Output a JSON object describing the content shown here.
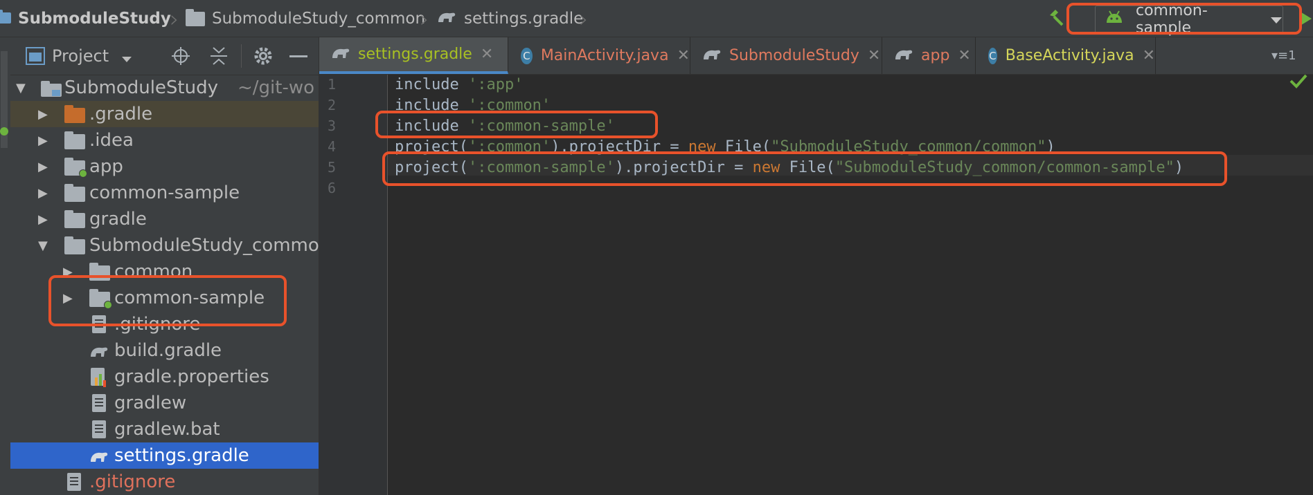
{
  "breadcrumb": [
    {
      "label": "SubmoduleStudy",
      "icon": "project-icon"
    },
    {
      "label": "SubmoduleStudy_common",
      "icon": "folder-icon"
    },
    {
      "label": "settings.gradle",
      "icon": "gradle-icon"
    }
  ],
  "run_config": {
    "label": "common-sample",
    "icon": "android-icon"
  },
  "project_panel": {
    "title": "Project",
    "tree": [
      {
        "label": "SubmoduleStudy",
        "suffix": "~/git-wo",
        "icon": "project-folder-icon",
        "expanded": true,
        "depth": 0
      },
      {
        "label": ".gradle",
        "icon": "folder-orange-icon",
        "expanded": false,
        "depth": 1
      },
      {
        "label": ".idea",
        "icon": "folder-icon",
        "expanded": false,
        "depth": 1
      },
      {
        "label": "app",
        "icon": "module-folder-icon",
        "expanded": false,
        "depth": 1
      },
      {
        "label": "common-sample",
        "icon": "folder-icon",
        "expanded": false,
        "depth": 1
      },
      {
        "label": "gradle",
        "icon": "folder-icon",
        "expanded": false,
        "depth": 1
      },
      {
        "label": "SubmoduleStudy_commo",
        "icon": "folder-icon",
        "expanded": true,
        "depth": 1
      },
      {
        "label": "common",
        "icon": "library-folder-icon",
        "expanded": false,
        "depth": 2
      },
      {
        "label": "common-sample",
        "icon": "module-folder-icon",
        "expanded": false,
        "depth": 2
      },
      {
        "label": ".gitignore",
        "icon": "file-icon",
        "depth": 2
      },
      {
        "label": "build.gradle",
        "icon": "gradle-icon",
        "depth": 2
      },
      {
        "label": "gradle.properties",
        "icon": "properties-icon",
        "depth": 2
      },
      {
        "label": "gradlew",
        "icon": "file-icon",
        "depth": 2
      },
      {
        "label": "gradlew.bat",
        "icon": "file-icon",
        "depth": 2
      },
      {
        "label": "settings.gradle",
        "icon": "gradle-icon",
        "depth": 2,
        "selected": true
      },
      {
        "label": ".gitignore",
        "icon": "file-icon",
        "depth": 1,
        "ignored": true
      }
    ]
  },
  "tabs": [
    {
      "label": "settings.gradle",
      "icon": "gradle-icon",
      "active": true,
      "color": "#a8c023"
    },
    {
      "label": "MainActivity.java",
      "icon": "class-icon",
      "active": false,
      "color": "#e07a5f"
    },
    {
      "label": "SubmoduleStudy",
      "icon": "gradle-icon",
      "active": false,
      "color": "#e07a5f"
    },
    {
      "label": "app",
      "icon": "gradle-icon",
      "active": false,
      "color": "#e07a5f"
    },
    {
      "label": "BaseActivity.java",
      "icon": "class-icon",
      "active": false,
      "color": "#d5d65a"
    }
  ],
  "editor": {
    "lines": [
      {
        "num": "1",
        "parts": [
          {
            "t": "include ",
            "c": "plain"
          },
          {
            "t": "':app'",
            "c": "str"
          }
        ]
      },
      {
        "num": "2",
        "parts": [
          {
            "t": "include ",
            "c": "plain"
          },
          {
            "t": "':common'",
            "c": "str"
          }
        ]
      },
      {
        "num": "3",
        "parts": [
          {
            "t": "include ",
            "c": "plain"
          },
          {
            "t": "':common-sample'",
            "c": "str"
          }
        ]
      },
      {
        "num": "4",
        "parts": [
          {
            "t": "project(",
            "c": "plain"
          },
          {
            "t": "':common'",
            "c": "str"
          },
          {
            "t": ").projectDir = ",
            "c": "plain"
          },
          {
            "t": "new",
            "c": "kw"
          },
          {
            "t": " File(",
            "c": "plain"
          },
          {
            "t": "\"SubmoduleStudy_common/common\"",
            "c": "str"
          },
          {
            "t": ")",
            "c": "plain"
          }
        ]
      },
      {
        "num": "5",
        "parts": [
          {
            "t": "project(",
            "c": "plain"
          },
          {
            "t": "':common-sample'",
            "c": "str"
          },
          {
            "t": ").projectDir = ",
            "c": "plain"
          },
          {
            "t": "new",
            "c": "kw"
          },
          {
            "t": " File(",
            "c": "plain"
          },
          {
            "t": "\"SubmoduleStudy_common/common-sample\"",
            "c": "str"
          },
          {
            "t": ")",
            "c": "plain"
          }
        ]
      },
      {
        "num": "6",
        "parts": []
      }
    ]
  },
  "colors": {
    "highlight": "#e8522b",
    "selection": "#2f65ca",
    "accent_green": "#6db33f"
  }
}
